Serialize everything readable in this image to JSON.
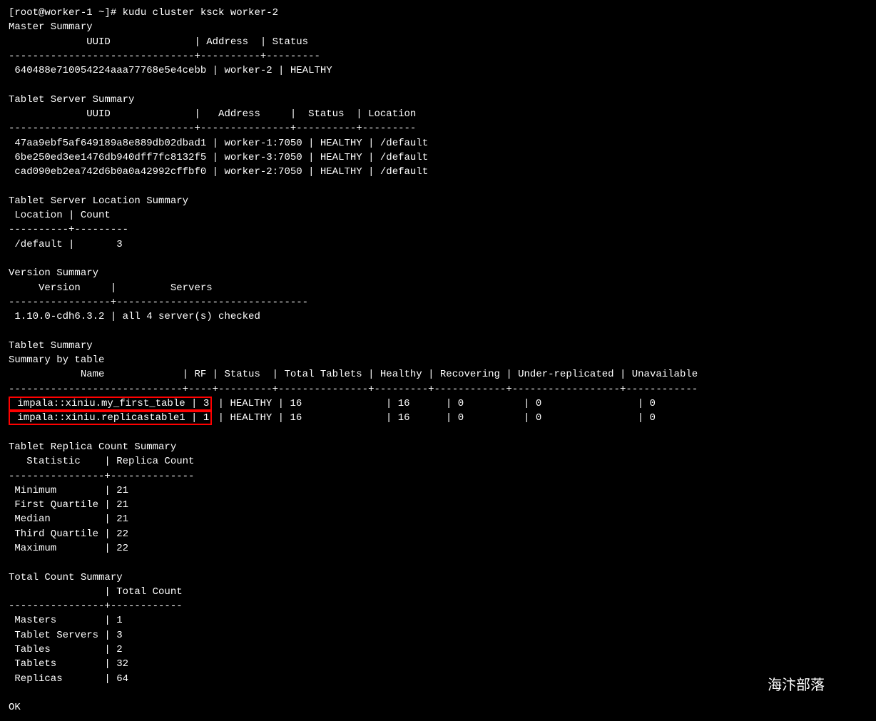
{
  "terminal": {
    "prompt": "[root@worker-1 ~]# kudu cluster ksck worker-2",
    "master_summary_header": "Master Summary",
    "master_table_header": "             UUID              | Address  | Status",
    "master_table_divider": "-------------------------------+----------+---------",
    "master_row": " 640488e710054224aaa77768e5e4cebb | worker-2 | HEALTHY",
    "tablet_server_summary_header": "Tablet Server Summary",
    "tablet_server_header": "             UUID              |   Address     |  Status  | Location",
    "tablet_server_divider": "-------------------------------+---------------+----------+---------",
    "tablet_server_rows": [
      " 47aa9ebf5af649189a8e889db02dbad1 | worker-1:7050 | HEALTHY | /default",
      " 6be250ed3ee1476db940dff7fc8132f5 | worker-3:7050 | HEALTHY | /default",
      " cad090eb2ea742d6b0a0a42992cffbf0 | worker-2:7050 | HEALTHY | /default"
    ],
    "tablet_server_location_header": "Tablet Server Location Summary",
    "location_header": " Location | Count",
    "location_divider": "----------+---------",
    "location_row": " /default |       3",
    "version_summary_header": "Version Summary",
    "version_header": "     Version     |         Servers",
    "version_divider": "-----------------+--------------------------------",
    "version_row": " 1.10.0-cdh6.3.2 | all 4 server(s) checked",
    "tablet_summary_header": "Tablet Summary",
    "summary_by_table": "Summary by table",
    "table_header": "            Name             | RF | Status  | Total Tablets | Healthy | Recovering | Under-replicated | Unavailable",
    "table_divider": "-----------------------------+----+---------+---------------+---------+------------+------------------+------------",
    "table_rows": [
      {
        "name": "impala::xiniu.my_first_table",
        "rf": "3",
        "status": "HEALTHY",
        "total": "16",
        "healthy": "16",
        "recovering": "0",
        "under": "0",
        "unavail": "0"
      },
      {
        "name": "impala::xiniu.replicastable1",
        "rf": "1",
        "status": "HEALTHY",
        "total": "16",
        "healthy": "16",
        "recovering": "0",
        "under": "0",
        "unavail": "0"
      }
    ],
    "replica_count_header": "Tablet Replica Count Summary",
    "statistic_header": "   Statistic    | Replica Count",
    "statistic_divider": "----------------+--------------",
    "statistic_rows": [
      " Minimum        | 21",
      " First Quartile | 21",
      " Median         | 21",
      " Third Quartile | 22",
      " Maximum        | 22"
    ],
    "total_count_header": "Total Count Summary",
    "total_count_col_header": "                | Total Count",
    "total_count_divider": "----------------+------------",
    "total_count_rows": [
      " Masters        | 1",
      " Tablet Servers | 3",
      " Tables         | 2",
      " Tablets        | 32",
      " Replicas       | 64"
    ],
    "ok_text": "OK",
    "watermark": "海汴部落"
  }
}
